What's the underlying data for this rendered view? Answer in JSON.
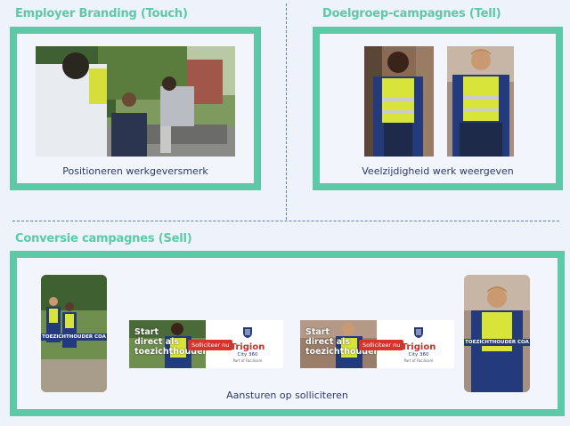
{
  "sections": {
    "touch": {
      "title": "Employer Branding (Touch)",
      "caption": "Positioneren werkgeversmerk",
      "photo_icon": "group-outdoor-photo"
    },
    "tell": {
      "title": "Doelgroep-campagnes (Tell)",
      "caption": "Veelzijdigheid werk weergeven",
      "photo_icons": [
        "female-security-officer-photo",
        "male-security-officer-photo"
      ]
    },
    "sell": {
      "title": "Conversie campagnes (Sell)",
      "caption": "Aansturen op solliciteren",
      "story_left": {
        "label": "TOEZICHTHOUDER COA"
      },
      "story_right": {
        "label": "TOEZICHTHOUDER COA"
      },
      "banners": [
        {
          "headline_1": "Start",
          "headline_2": "direct als",
          "headline_3": "toezichthouder",
          "cta": "Solliciteer nu",
          "brand": "Trigion",
          "brand_sub": "City 360",
          "brand_part": "Part of Facilicom"
        },
        {
          "headline_1": "Start",
          "headline_2": "direct als",
          "headline_3": "toezichthouder",
          "cta": "Solliciteer nu",
          "brand": "Trigion",
          "brand_sub": "City 360",
          "brand_part": "Part of Facilicom"
        }
      ]
    }
  },
  "colors": {
    "accent": "#5cc9a7",
    "text": "#2a3a6b",
    "background": "#eef2fb",
    "divider": "#5a7fbf",
    "brand_red": "#c8302a",
    "brand_blue": "#233a7d"
  }
}
